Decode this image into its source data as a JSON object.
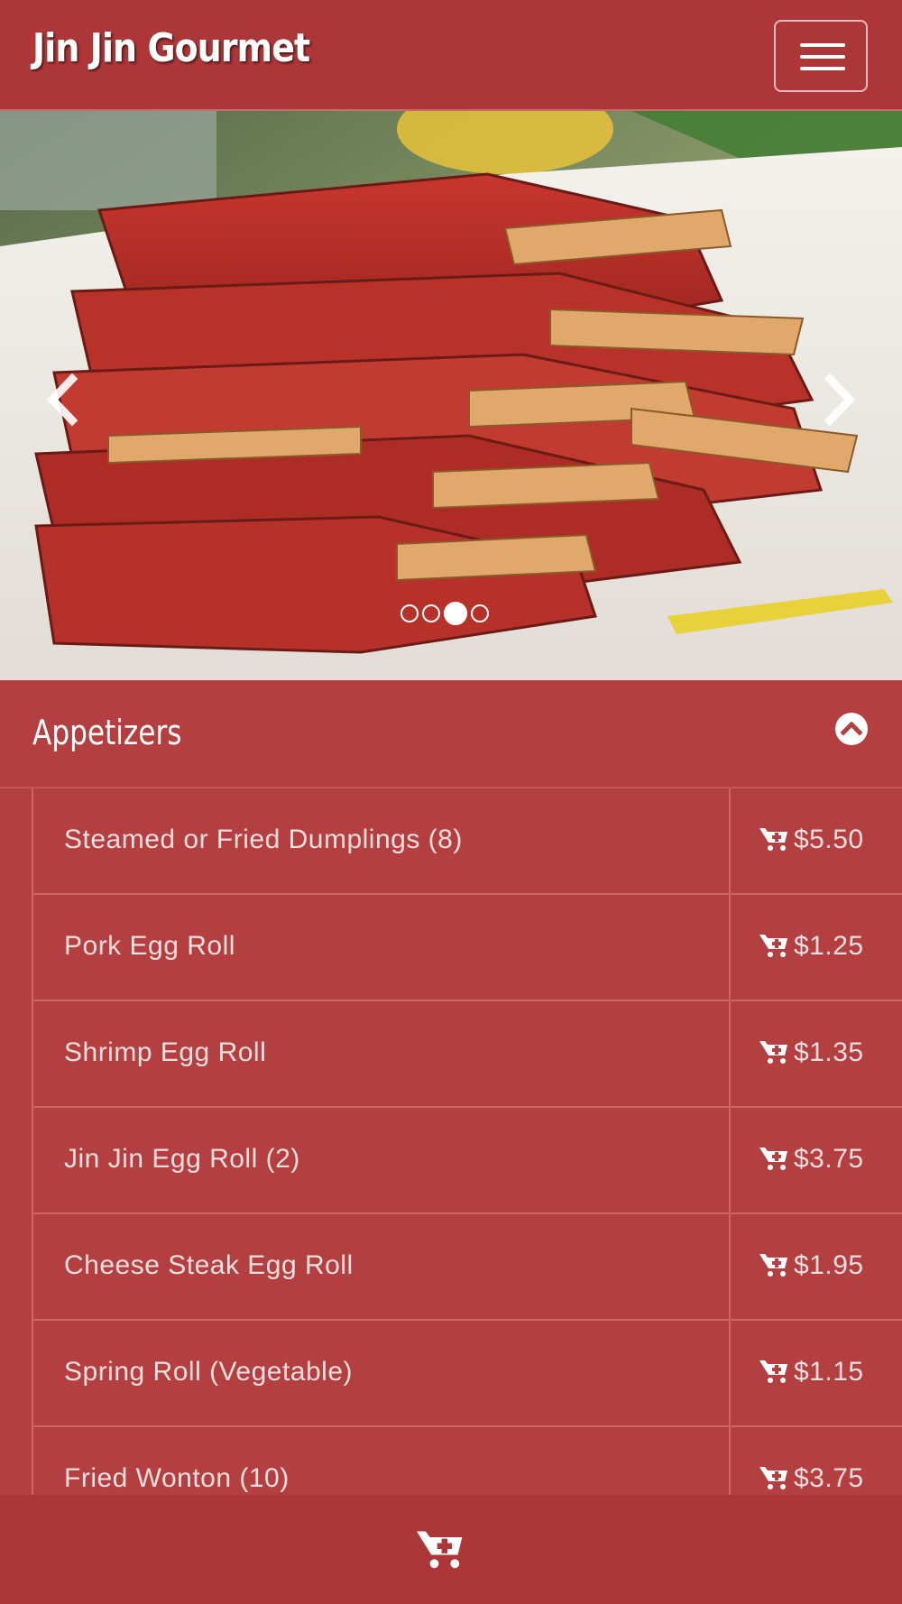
{
  "navbar": {
    "brand": "Jin Jin Gourmet",
    "toggle_icon": "hamburger-menu-icon"
  },
  "carousel": {
    "image": "braised-spare-ribs-photo",
    "prev_icon": "chevron-left-icon",
    "next_icon": "chevron-right-icon",
    "slide_count": 4,
    "active_slide": 3
  },
  "category": {
    "title": "Appetizers",
    "collapse_icon": "chevron-up-circle-icon"
  },
  "items": [
    {
      "name": "Steamed or Fried Dumplings (8)",
      "price": "$5.50"
    },
    {
      "name": "Pork Egg Roll",
      "price": "$1.25"
    },
    {
      "name": "Shrimp Egg Roll",
      "price": "$1.35"
    },
    {
      "name": "Jin Jin Egg Roll (2)",
      "price": "$3.75"
    },
    {
      "name": "Cheese Steak Egg Roll",
      "price": "$1.95"
    },
    {
      "name": "Spring Roll (Vegetable)",
      "price": "$1.15"
    },
    {
      "name": "Fried Wonton (10)",
      "price": "$3.75"
    }
  ],
  "cart": {
    "item_icon": "cart-plus-icon",
    "bottom_icon": "cart-plus-icon"
  },
  "colors": {
    "navbar": "#ad3638",
    "background": "#b43f41",
    "divider": "#cf6465",
    "text": "#ffffff"
  }
}
